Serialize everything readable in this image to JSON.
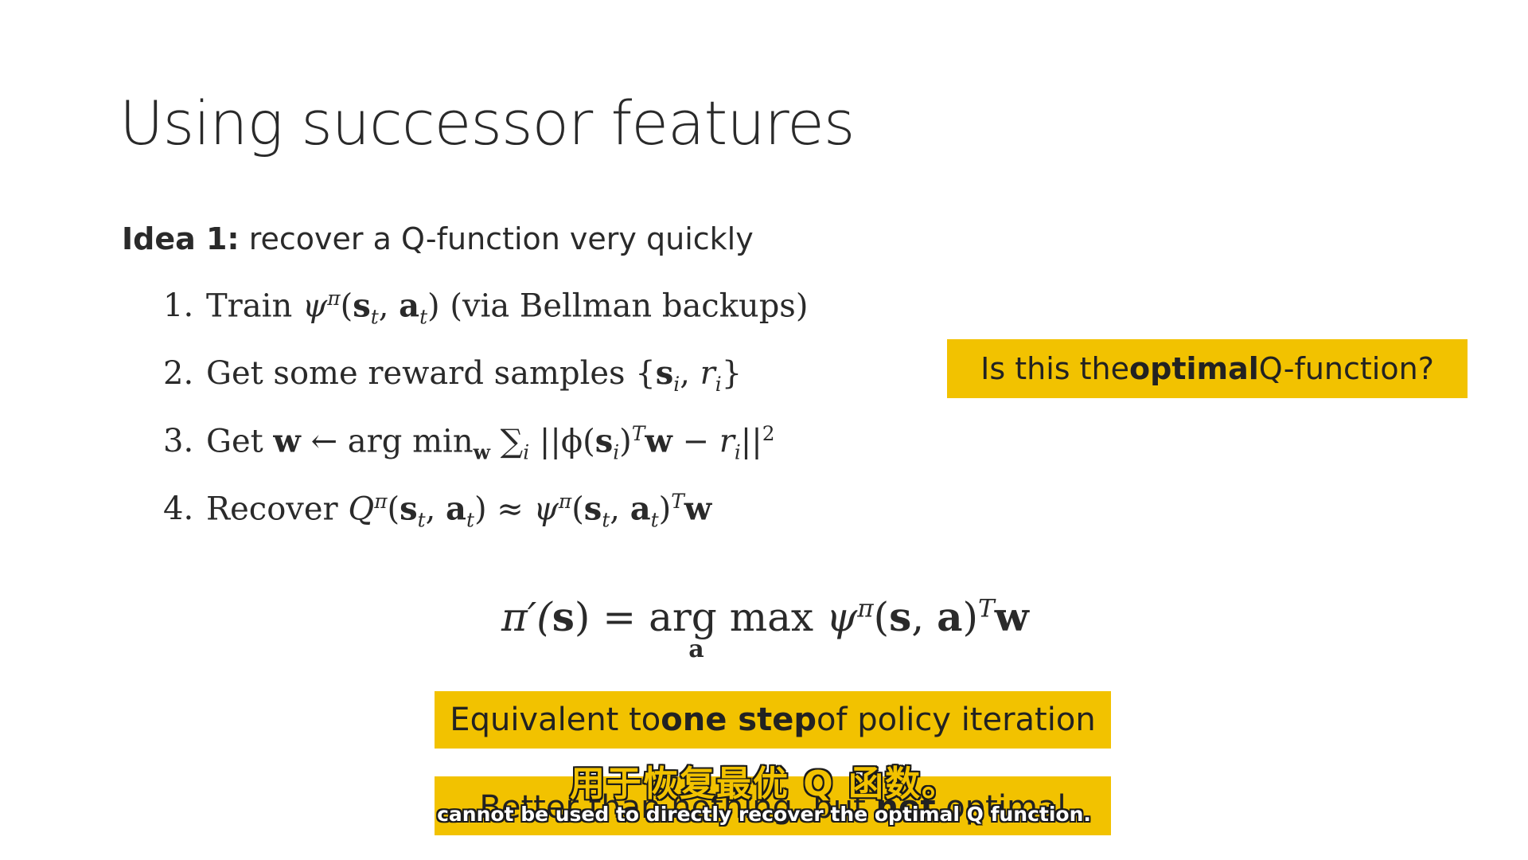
{
  "slide": {
    "title": "Using successor features",
    "idea_label": "Idea 1:",
    "idea_text": " recover a Q-function very quickly",
    "steps": [
      {
        "num": "1.",
        "parts": [
          "Train ",
          "ψ",
          "π",
          "(",
          "s",
          "t",
          ", ",
          "a",
          "t",
          ") (via Bellman backups)"
        ]
      },
      {
        "num": "2.",
        "parts": [
          "Get some reward samples {",
          "s",
          "i",
          ", ",
          "r",
          "i",
          "}"
        ]
      },
      {
        "num": "3.",
        "parts": [
          "Get ",
          "w",
          " ← arg min",
          "w",
          " ∑",
          "i",
          " ||ϕ(",
          "s",
          "i",
          ")",
          "T",
          "w",
          " − ",
          "r",
          "i",
          "||",
          "2"
        ]
      },
      {
        "num": "4.",
        "parts": [
          "Recover ",
          "Q",
          "π",
          "(",
          "s",
          "t",
          ", ",
          "a",
          "t",
          ") ≈ ",
          "ψ",
          "π",
          "(",
          "s",
          "t",
          ", ",
          "a",
          "t",
          ")",
          "T",
          "w"
        ]
      }
    ],
    "callout_question": {
      "pre": "Is this the ",
      "bold": "optimal",
      "post": " Q-function?"
    },
    "policy_equation": {
      "lhs": "π′(",
      "s": "s",
      "mid": ") = arg max",
      "under": "a",
      "psi": "ψ",
      "pi": "π",
      "open": "(",
      "s2": "s",
      "comma": ", ",
      "a": "a",
      "close": ")",
      "T": "T",
      "w": "w"
    },
    "callout_equivalent": {
      "pre": "Equivalent to ",
      "bold": "one step",
      "post": " of policy iteration"
    },
    "callout_better": {
      "pre": "Better than nothing, but ",
      "bold": "not",
      "post": " optimal"
    }
  },
  "subtitles": {
    "zh": "用于恢复最优 Q 函数。",
    "en": "cannot be used to directly recover the optimal Q function."
  },
  "colors": {
    "accent": "#f2c200",
    "text": "#2a2a2a",
    "background": "#ffffff"
  }
}
